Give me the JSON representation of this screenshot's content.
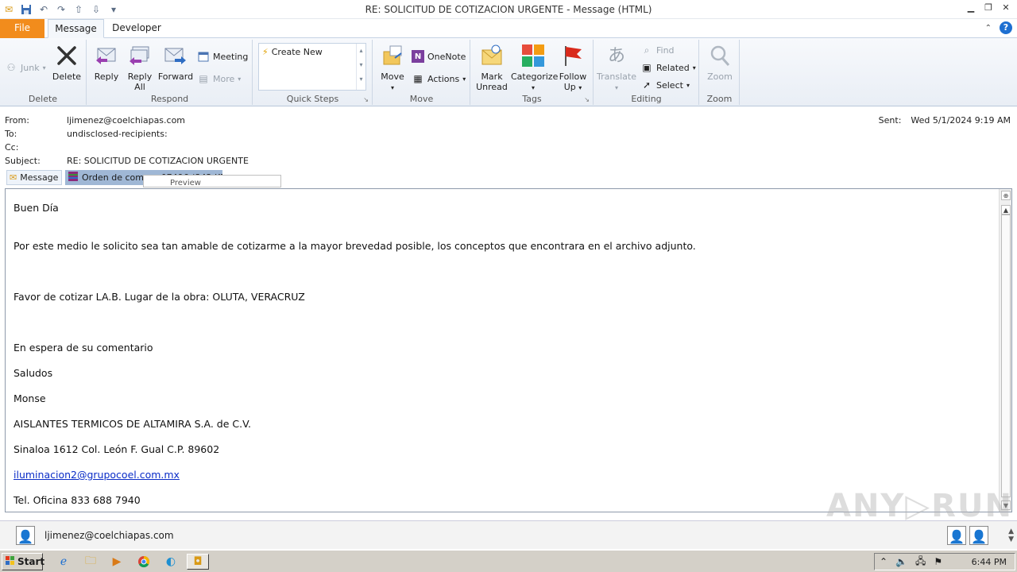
{
  "window": {
    "title": "RE: SOLICITUD DE COTIZACION URGENTE  -  Message (HTML)"
  },
  "tabs": {
    "file": "File",
    "message": "Message",
    "developer": "Developer"
  },
  "ribbon": {
    "delete_group": {
      "label": "Delete",
      "junk": "Junk",
      "delete": "Delete"
    },
    "respond_group": {
      "label": "Respond",
      "reply": "Reply",
      "reply_all_1": "Reply",
      "reply_all_2": "All",
      "forward": "Forward",
      "meeting": "Meeting",
      "more": "More"
    },
    "quick_steps_group": {
      "label": "Quick Steps",
      "create_new": "Create New"
    },
    "move_group": {
      "label": "Move",
      "move": "Move",
      "onenote": "OneNote",
      "actions": "Actions"
    },
    "tags_group": {
      "label": "Tags",
      "mark_unread_1": "Mark",
      "mark_unread_2": "Unread",
      "categorize": "Categorize",
      "follow_up_1": "Follow",
      "follow_up_2": "Up"
    },
    "editing_group": {
      "label": "Editing",
      "translate": "Translate",
      "find": "Find",
      "related": "Related",
      "select": "Select"
    },
    "zoom_group": {
      "label": "Zoom",
      "zoom": "Zoom"
    }
  },
  "header": {
    "from_label": "From:",
    "from_value": "ljimenez@coelchiapas.com",
    "to_label": "To:",
    "to_value": "undisclosed-recipients:",
    "cc_label": "Cc:",
    "cc_value": "",
    "subject_label": "Subject:",
    "subject_value": "RE: SOLICITUD DE COTIZACION URGENTE",
    "sent_label": "Sent:",
    "sent_value": "Wed 5/1/2024 9:19 AM"
  },
  "attachments": {
    "message_tab": "Message",
    "file_name": "Orden de compra 07496 (342 KB)",
    "popup_text": "Preview"
  },
  "body": {
    "greeting": "Buen Día",
    "line1": "Por este medio le solicito sea tan amable de cotizarme a la mayor brevedad posible, los conceptos que encontrara en el archivo adjunto.",
    "line2": "Favor de cotizar LA.B. Lugar de la obra: OLUTA, VERACRUZ",
    "line3": "En espera de su comentario",
    "line4": "Saludos",
    "line5": "Monse",
    "line6": "AISLANTES TERMICOS DE ALTAMIRA S.A. de C.V.",
    "line7": "Sinaloa 1612 Col. León F. Gual C.P. 89602",
    "link": "iluminacion2@grupocoel.com.mx",
    "line8": "Tel. Oficina 833 688 7940"
  },
  "people_pane": {
    "email": "ljimenez@coelchiapas.com"
  },
  "taskbar": {
    "start": "Start",
    "clock": "6:44 PM"
  },
  "watermark": "ANY▷RUN"
}
